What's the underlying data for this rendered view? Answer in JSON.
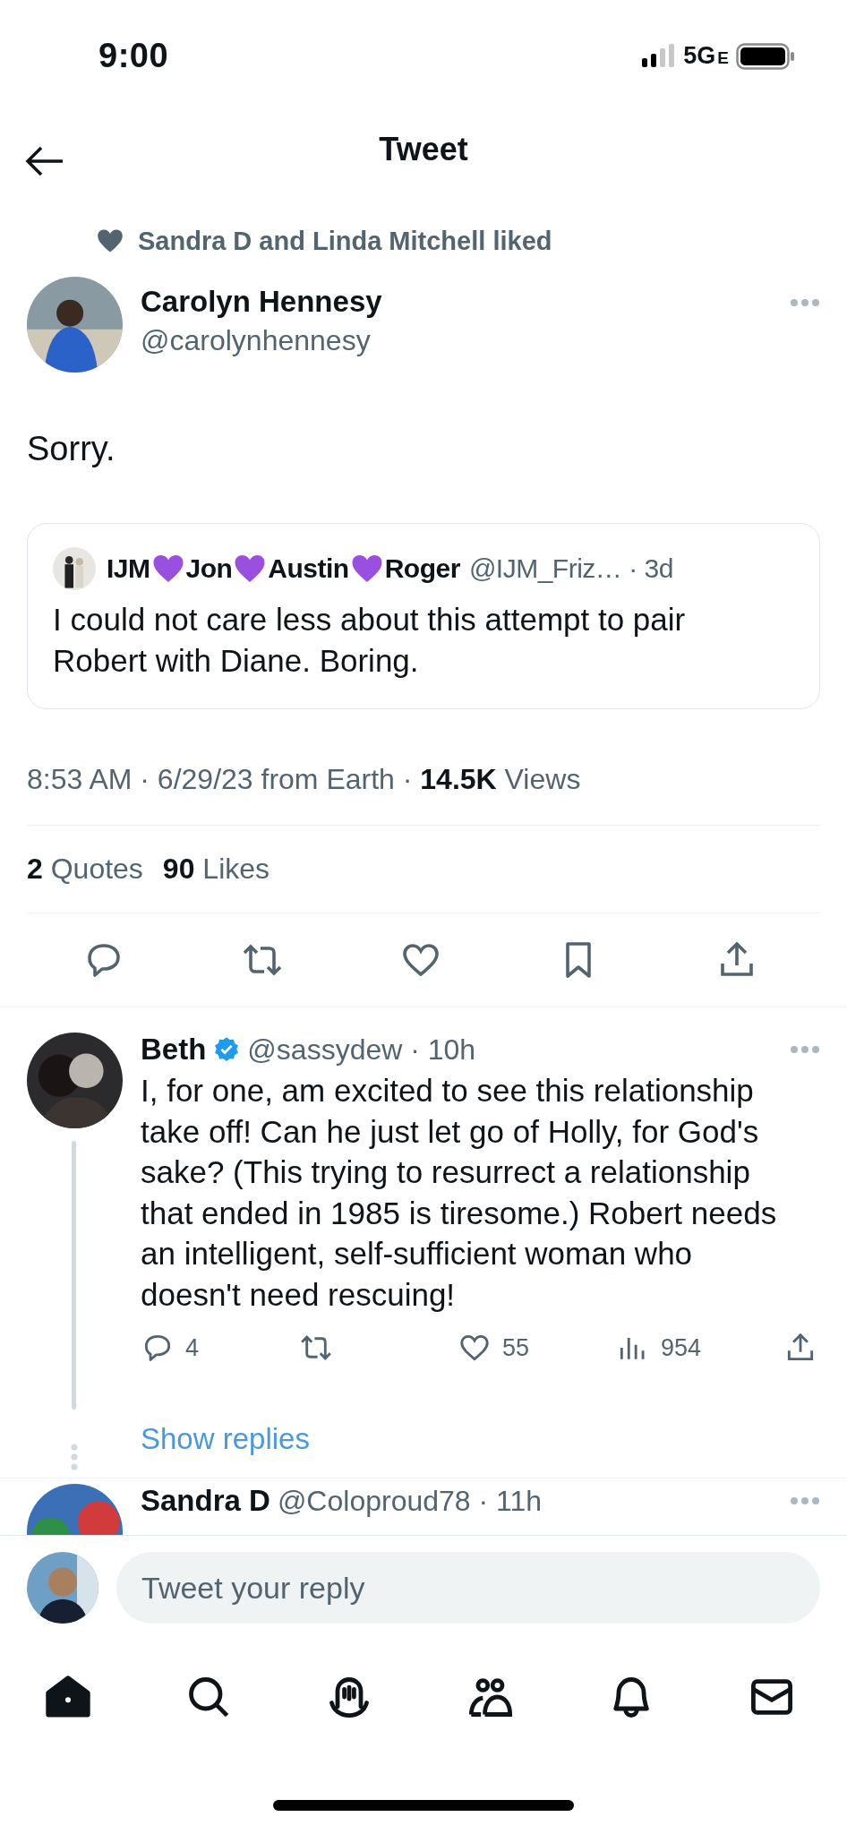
{
  "status_bar": {
    "time": "9:00",
    "network": "5G",
    "network_suffix": "E"
  },
  "header": {
    "title": "Tweet"
  },
  "social_context": "Sandra D and Linda Mitchell liked",
  "tweet": {
    "author": {
      "name": "Carolyn Hennesy",
      "handle": "@carolynhennesy"
    },
    "text": "Sorry.",
    "quote": {
      "name_parts": [
        "IJM",
        "Jon",
        "Austin",
        "Roger"
      ],
      "handle_line": "@IJM_Friz… · 3d",
      "text": "I could not care less about this attempt to pair Robert with Diane. Boring."
    },
    "meta": "8:53 AM · 6/29/23 from Earth · **14.5K** Views",
    "stats": [
      "**2** Quotes",
      "**90** Likes"
    ],
    "actions": [
      {
        "kind": "reply"
      },
      {
        "kind": "retweet"
      },
      {
        "kind": "like"
      },
      {
        "kind": "bookmark"
      },
      {
        "kind": "share"
      }
    ]
  },
  "replies": [
    {
      "name": "Beth",
      "verified": true,
      "handle_line": "@sassydew · 10h",
      "text": "I, for one, am excited to see this relationship take off!  Can he just let go of Holly, for God's sake? (This trying to resurrect a relationship that ended in 1985 is tiresome.) Robert needs an intelligent, self-sufficient woman who doesn't need rescuing!",
      "actions": [
        {
          "kind": "reply",
          "count": "4"
        },
        {
          "kind": "retweet"
        },
        {
          "kind": "like",
          "count": "55"
        },
        {
          "kind": "views",
          "count": "954"
        },
        {
          "kind": "share"
        }
      ],
      "show_replies": "Show replies"
    },
    {
      "name": "Sandra D",
      "handle_line": "@Coloproud78 · 11h"
    }
  ],
  "composer": {
    "placeholder": "Tweet your reply"
  },
  "nav": [
    {
      "kind": "home",
      "selected": true
    },
    {
      "kind": "search",
      "selected": false
    },
    {
      "kind": "spaces",
      "selected": false
    },
    {
      "kind": "communities",
      "selected": false
    },
    {
      "kind": "notifications",
      "selected": false
    },
    {
      "kind": "messages",
      "selected": false
    }
  ]
}
